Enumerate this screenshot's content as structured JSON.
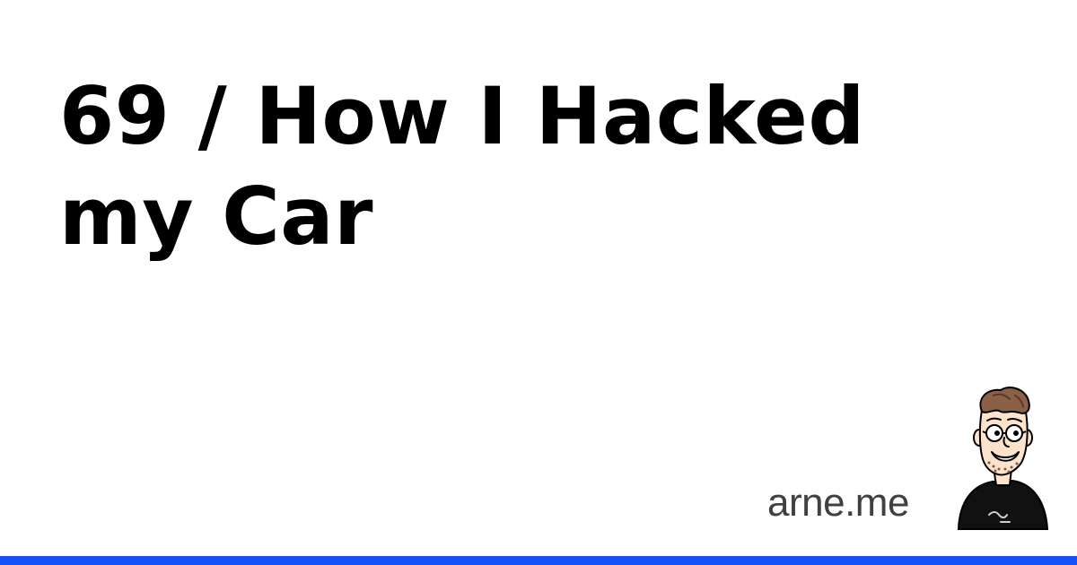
{
  "title": "69 / How I Hacked my Car",
  "site": "arne.me",
  "avatar": {
    "icon": "person-cartoon-icon"
  },
  "colors": {
    "background": "#ffffff",
    "title": "#000000",
    "site": "#404040",
    "accent_bar": "#1651f5",
    "avatar_shirt": "#111111",
    "avatar_skin": "#fde3cc",
    "avatar_hair": "#8a6046"
  }
}
